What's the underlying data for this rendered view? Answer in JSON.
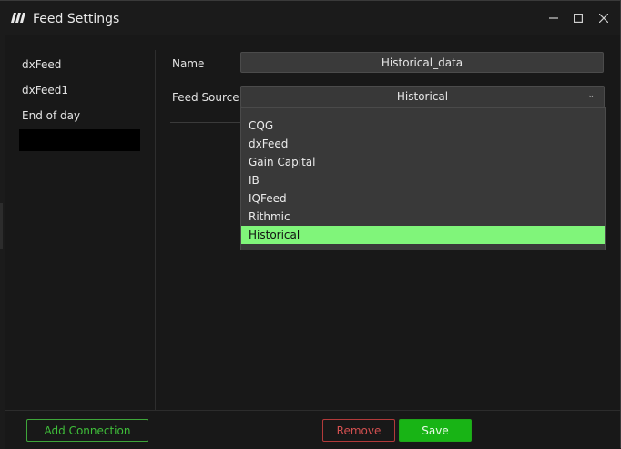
{
  "window": {
    "title": "Feed Settings",
    "controls": {
      "minimize": "minimize-icon",
      "maximize": "maximize-icon",
      "close": "close-icon"
    }
  },
  "sidebar": {
    "items": [
      {
        "label": "dxFeed"
      },
      {
        "label": "dxFeed1"
      },
      {
        "label": "End of day"
      },
      {
        "label": ""
      }
    ]
  },
  "form": {
    "name_label": "Name",
    "name_value": "Historical_data",
    "feed_source_label": "Feed Source",
    "feed_source_value": "Historical"
  },
  "dropdown": {
    "options": [
      "CQG",
      "dxFeed",
      "Gain Capital",
      "IB",
      "IQFeed",
      "Rithmic",
      "Historical"
    ],
    "highlighted": "Historical"
  },
  "footer": {
    "add_label": "Add Connection",
    "remove_label": "Remove",
    "save_label": "Save"
  },
  "colors": {
    "accent_green": "#18b415",
    "highlight_green": "#80f57a",
    "danger_red": "#d45050",
    "background": "#1b1b1b"
  }
}
